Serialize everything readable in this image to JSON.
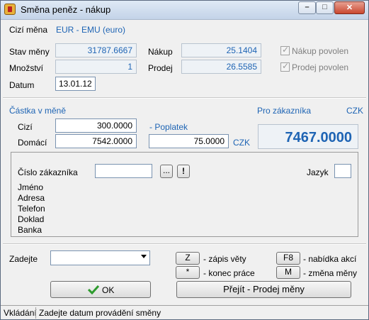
{
  "window": {
    "title": "Směna peněz - nákup"
  },
  "header": {
    "foreign_currency_label": "Cizí měna",
    "foreign_currency_value": "EUR - EMU (euro)",
    "balance_label": "Stav měny",
    "balance_value": "31787.6667",
    "quantity_label": "Množství",
    "quantity_value": "1",
    "date_label": "Datum",
    "date_value": "13.01.12",
    "purchase_label": "Nákup",
    "purchase_value": "25.1404",
    "sale_label": "Prodej",
    "sale_value": "26.5585",
    "purchase_allowed_label": "Nákup povolen",
    "sale_allowed_label": "Prodej povolen"
  },
  "amount": {
    "section_label": "Částka v měně",
    "foreign_label": "Cizí",
    "foreign_value": "300.0000",
    "domestic_label": "Domácí",
    "domestic_value": "7542.0000",
    "fee_label": "- Poplatek",
    "fee_value": "75.0000",
    "fee_currency": "CZK",
    "customer_total_label": "Pro zákazníka",
    "customer_total_currency": "CZK",
    "customer_total_value": "7467.0000"
  },
  "customer": {
    "number_label": "Číslo zákazníka",
    "number_value": "",
    "browse_button": "...",
    "alert_button": "!",
    "language_label": "Jazyk",
    "language_value": "",
    "name_label": "Jméno",
    "address_label": "Adresa",
    "phone_label": "Telefon",
    "document_label": "Doklad",
    "bank_label": "Banka"
  },
  "entry": {
    "label": "Zadejte",
    "value": ""
  },
  "shortcuts": [
    {
      "key": "Z",
      "label": "- zápis věty"
    },
    {
      "key": "*",
      "label": "- konec práce"
    },
    {
      "key": "F8",
      "label": "- nabídka akcí"
    },
    {
      "key": "M",
      "label": "- změna měny"
    }
  ],
  "actions": {
    "ok_label": "OK",
    "switch_label": "Přejít - Prodej měny"
  },
  "status": {
    "mode": "Vkládání",
    "message": "Zadejte datum provádění směny"
  },
  "colors": {
    "accent": "#1e64b4",
    "ok_check": "#2e9b2e"
  }
}
